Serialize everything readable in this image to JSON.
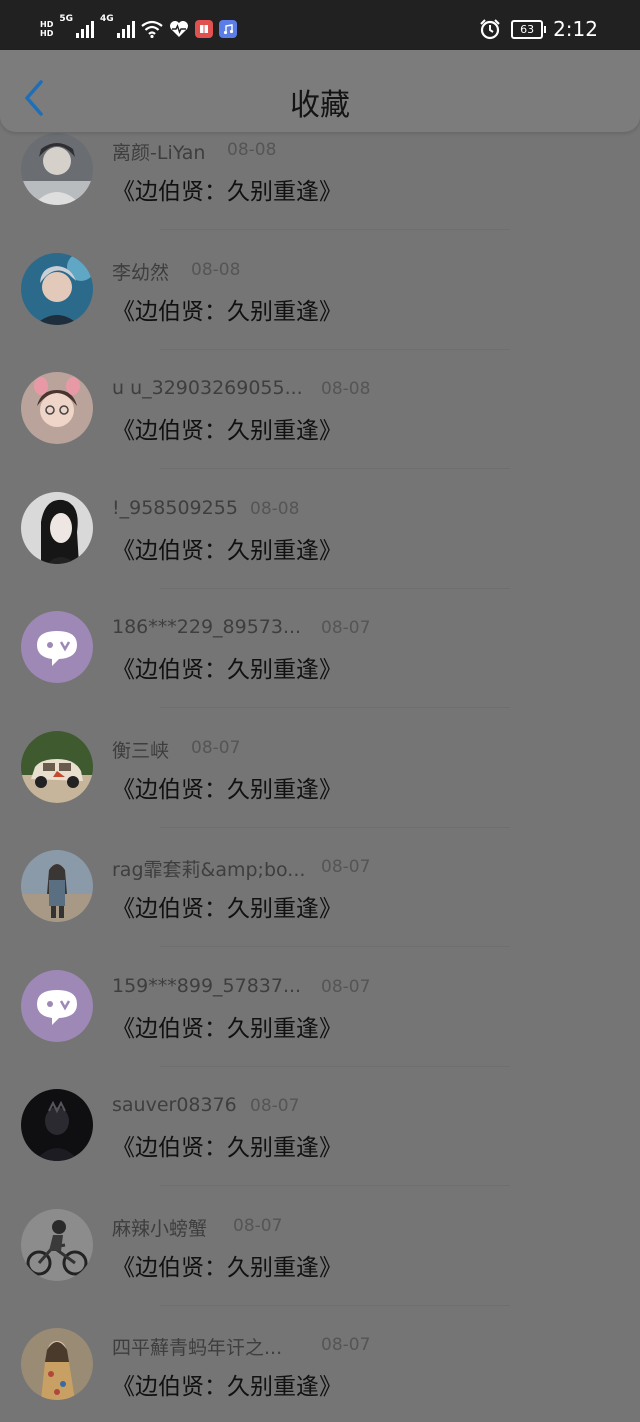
{
  "status_bar": {
    "hd_top": "HD",
    "hd_bottom": "HD",
    "network1": "5G",
    "network2": "4G",
    "battery": "63",
    "time": "2:12",
    "icons": [
      "signal-icon",
      "wifi-icon",
      "heart-rate-icon",
      "reader-app-icon",
      "music-app-icon",
      "alarm-icon"
    ]
  },
  "header": {
    "title": "收藏",
    "back_icon": "chevron-left-icon"
  },
  "colors": {
    "accent": "#1f6fb8",
    "background": "#757575",
    "placeholder_avatar": "#9d88b6"
  },
  "items": [
    {
      "user": "离颜-LiYan",
      "date": "08-08",
      "title": "《边伯贤：久别重逢》",
      "avatar": "photo"
    },
    {
      "user": "李幼然",
      "date": "08-08",
      "title": "《边伯贤：久别重逢》",
      "avatar": "photo"
    },
    {
      "user": "u u_32903269055...",
      "date": "08-08",
      "title": "《边伯贤：久别重逢》",
      "avatar": "photo"
    },
    {
      "user": "!_958509255",
      "date": "08-08",
      "title": "《边伯贤：久别重逢》",
      "avatar": "photo"
    },
    {
      "user": "186***229_89573...",
      "date": "08-07",
      "title": "《边伯贤：久别重逢》",
      "avatar": "default-chat-icon"
    },
    {
      "user": "衡三峡",
      "date": "08-07",
      "title": "《边伯贤：久别重逢》",
      "avatar": "photo"
    },
    {
      "user": "rag霏套莉&amp;bo...",
      "date": "08-07",
      "title": "《边伯贤：久别重逢》",
      "avatar": "photo"
    },
    {
      "user": "159***899_57837...",
      "date": "08-07",
      "title": "《边伯贤：久别重逢》",
      "avatar": "default-chat-icon"
    },
    {
      "user": "sauver08376",
      "date": "08-07",
      "title": "《边伯贤：久别重逢》",
      "avatar": "photo"
    },
    {
      "user": "麻辣小螃蟹",
      "date": "08-07",
      "title": "《边伯贤：久别重逢》",
      "avatar": "photo"
    },
    {
      "user": "四平蘚青蚂年讦之...",
      "date": "08-07",
      "title": "《边伯贤：久别重逢》",
      "avatar": "photo"
    }
  ]
}
